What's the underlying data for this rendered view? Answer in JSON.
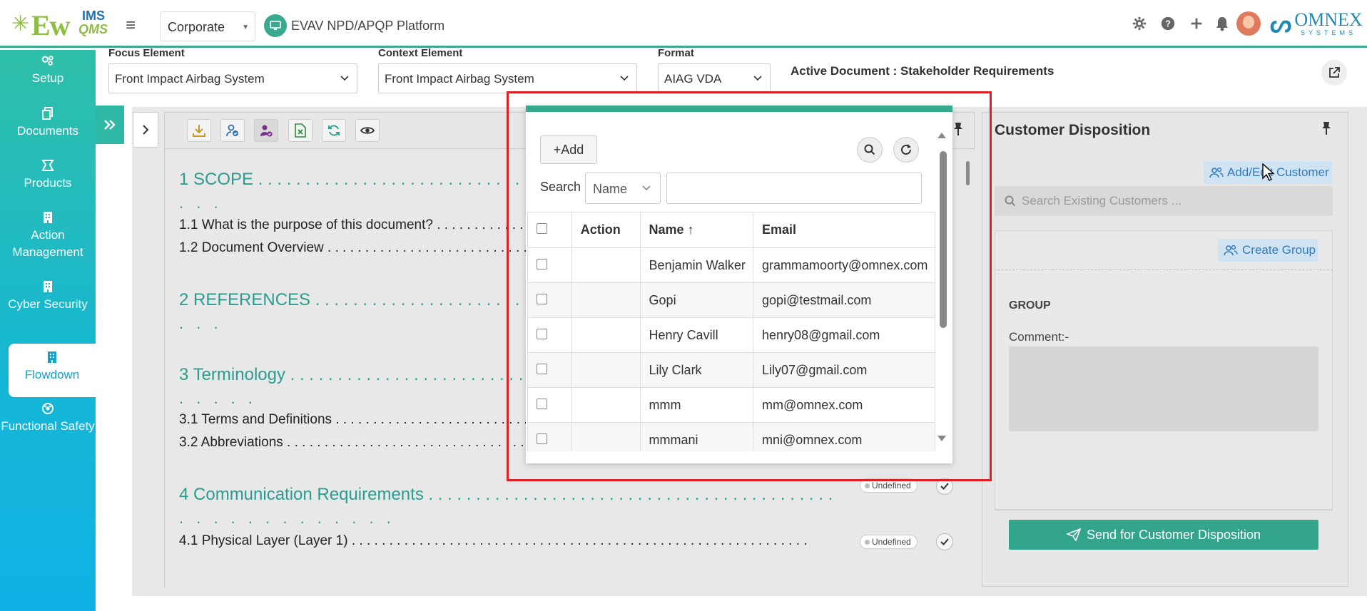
{
  "app": {
    "logo_ew": "Ew",
    "logo_ims": "IMS",
    "logo_qms": "QMS",
    "org_select": "Corporate",
    "platform_name": "EVAV NPD/APQP Platform",
    "brand_name": "OMNEX",
    "brand_sub": "SYSTEMS",
    "accent_color": "#3aa98f"
  },
  "top_icons": [
    "gear-icon",
    "help-icon",
    "plus-icon",
    "bell-icon"
  ],
  "sidebar": {
    "items": [
      {
        "label": "Setup",
        "icon": "gears-icon"
      },
      {
        "label": "Documents",
        "icon": "documents-icon"
      },
      {
        "label": "Products",
        "icon": "products-icon"
      },
      {
        "label": "Action Management",
        "icon": "building-icon"
      },
      {
        "label": "Cyber Security",
        "icon": "building-icon"
      },
      {
        "label": "Flowdown",
        "icon": "building-icon",
        "active": true
      },
      {
        "label": "Functional Safety",
        "icon": "safety-icon"
      }
    ]
  },
  "filters": {
    "focus_label": "Focus Element",
    "focus_value": "Front Impact Airbag System",
    "context_label": "Context Element",
    "context_value": "Front Impact Airbag System",
    "format_label": "Format",
    "format_value": "AIAG VDA",
    "active_document": "Active Document : Stakeholder Requirements"
  },
  "document": {
    "toolbar": [
      "download-icon",
      "user-check-icon",
      "user-assign-icon",
      "excel-icon",
      "refresh-icon",
      "eye-icon"
    ],
    "sections": [
      {
        "title": "1 SCOPE . . . . . . . . . . . . . . . . . . . . . . . . . . . . . . . . . . . . . . . .",
        "wrap": ". . ."
      },
      {
        "title": "1.1 What is the purpose of this document? . . . . . . . . . . . . . . . . . . . . . . . . . . . . ."
      },
      {
        "title": "1.2 Document Overview . . . . . . . . . . . . . . . . . . . . . . . . . . . . . . . . . . . . . . . . . . . . ."
      },
      {
        "title": "2 REFERENCES . . . . . . . . . . . . . . . . . . . . . . . . . . . . . . . . . . . . . .",
        "wrap": ". . ."
      },
      {
        "title": "3 Terminology . . . . . . . . . . . . . . . . . . . . . . . . . . . . . . . . . . . . . .",
        "wrap": ". . . . ."
      },
      {
        "title": "3.1 Terms and Definitions . . . . . . . . . . . . . . . . . . . . . . . . . . . . . . . . . . . . . . . . . . . . . . ."
      },
      {
        "title": "3.2 Abbreviations . . . . . . . . . . . . . . . . . . . . . . . . . . . . . . . . . . . . . . . . . . . . . . . . . . . . . . ."
      },
      {
        "title": "4 Communication Requirements . . . . . . . . . . . . . . . . . . . . . . . . . . . . . . . . . . . . . . . . . . .",
        "wrap": ". . . . . . . . . . . . .",
        "status": "Undefined"
      },
      {
        "title": "4.1 Physical Layer (Layer 1) . . . . . . . . . . . . . . . . . . . . . . . . . . . . . . . . . . . . . . . . . . . . . . . . . . . . . . . . . . . . .",
        "status": "Undefined"
      }
    ]
  },
  "customer_panel": {
    "title": "Customer Disposition",
    "add_edit_label": "Add/Edit Customer",
    "search_placeholder": "Search Existing Customers ...",
    "create_group_label": "Create Group",
    "group_label": "GROUP",
    "comment_label": "Comment:-",
    "send_label": "Send for Customer Disposition"
  },
  "popup": {
    "add_label": "+Add",
    "search_label": "Search",
    "search_field": "Name",
    "search_value": "",
    "columns": [
      "Action",
      "Name",
      "Email"
    ],
    "sort_indicator": "↑",
    "rows": [
      {
        "name": "Benjamin Walker",
        "email": "grammamoorty@omnex.com"
      },
      {
        "name": "Gopi",
        "email": "gopi@testmail.com"
      },
      {
        "name": "Henry Cavill",
        "email": "henry08@gmail.com"
      },
      {
        "name": "Lily Clark",
        "email": "Lily07@gmail.com"
      },
      {
        "name": "mmm",
        "email": "mm@omnex.com"
      },
      {
        "name": "mmmani",
        "email": "mni@omnex.com"
      }
    ],
    "highlight_color": "#e01e25"
  }
}
